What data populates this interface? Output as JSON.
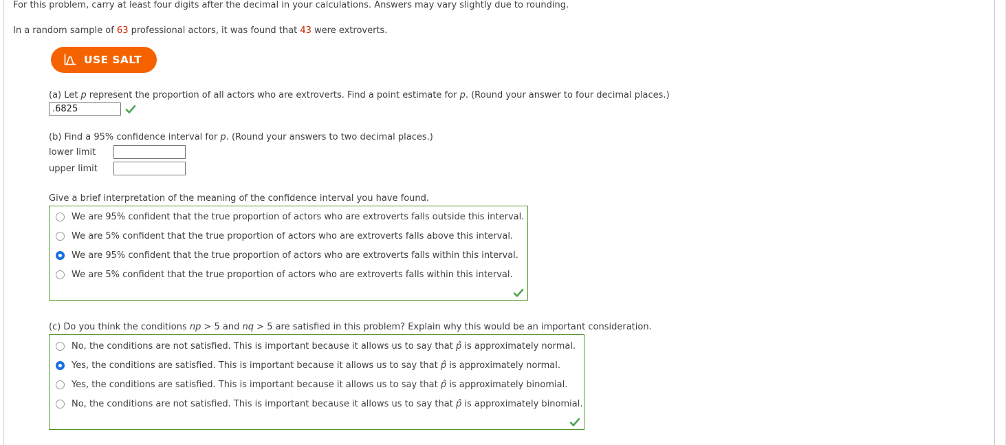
{
  "intro": {
    "line1": "For this problem, carry at least four digits after the decimal in your calculations. Answers may vary slightly due to rounding.",
    "line2_pre": "In a random sample of ",
    "line2_n": "63",
    "line2_mid": " professional actors, it was found that ",
    "line2_x": "43",
    "line2_post": " were extroverts."
  },
  "salt": {
    "label": "USE SALT",
    "icon": "normal-distribution-icon",
    "color": "#f56300"
  },
  "part_a": {
    "prompt_1": "(a) Let ",
    "prompt_p": "p",
    "prompt_2": " represent the proportion of all actors who are extroverts. Find a point estimate for ",
    "prompt_p2": "p",
    "prompt_3": ". (Round your answer to four decimal places.)",
    "answer_value": ".6825",
    "answer_placeholder": "",
    "status": "correct"
  },
  "part_b": {
    "prompt_1": "(b) Find a 95% confidence interval for ",
    "prompt_p": "p",
    "prompt_2": ". (Round your answers to two decimal places.)",
    "lower_label": "lower limit",
    "upper_label": "upper limit",
    "lower_value": "",
    "upper_value": "",
    "lower_placeholder": "",
    "upper_placeholder": ""
  },
  "interpretation": {
    "prompt": "Give a brief interpretation of the meaning of the confidence interval you have found.",
    "selected_index": 2,
    "status": "correct",
    "options": [
      "We are 95% confident that the true proportion of actors who are extroverts falls outside this interval.",
      "We are 5% confident that the true proportion of actors who are extroverts falls above this interval.",
      "We are 95% confident that the true proportion of actors who are extroverts falls within this interval.",
      "We are 5% confident that the true proportion of actors who are extroverts falls within this interval."
    ]
  },
  "part_c": {
    "prompt_1": "(c) Do you think the conditions ",
    "prompt_np": "np",
    "prompt_2": " > 5 and ",
    "prompt_nq": "nq",
    "prompt_3": " > 5 are satisfied in this problem? Explain why this would be an important consideration.",
    "selected_index": 1,
    "status": "correct",
    "options": [
      {
        "pre": "No, the conditions are not satisfied. This is important because it allows us to say that ",
        "sym": "p̂",
        "post": " is approximately normal."
      },
      {
        "pre": "Yes, the conditions are satisfied. This is important because it allows us to say that ",
        "sym": "p̂",
        "post": " is approximately normal."
      },
      {
        "pre": "Yes, the conditions are satisfied. This is important because it allows us to say that ",
        "sym": "p̂",
        "post": " is approximately binomial."
      },
      {
        "pre": "No, the conditions are not satisfied. This is important because it allows us to say that ",
        "sym": "p̂",
        "post": " is approximately binomial."
      }
    ]
  },
  "colors": {
    "accent_orange": "#f56300",
    "correct_green": "#5cb85c",
    "box_border_green": "#4f942b",
    "radio_blue": "#1a73e8",
    "number_red": "#cc2200"
  }
}
